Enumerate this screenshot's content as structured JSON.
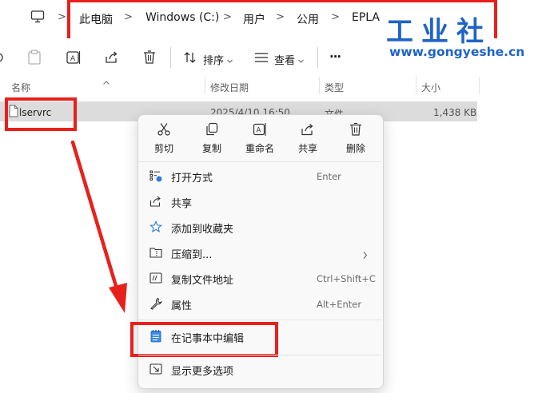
{
  "breadcrumb": {
    "items": [
      "此电脑",
      "Windows (C:)",
      "用户",
      "公用",
      "EPLA"
    ]
  },
  "toolbar": {
    "sort_label": "排序",
    "view_label": "查看",
    "more_label": "···"
  },
  "columns": {
    "name": "名称",
    "date": "修改日期",
    "type": "类型",
    "size": "大小"
  },
  "file": {
    "name": "lservrc",
    "date": "2025/4/10 16:50",
    "type": "文件",
    "size": "1,438 KB"
  },
  "context_menu": {
    "quick_actions": [
      {
        "label": "剪切",
        "icon": "scissors-icon"
      },
      {
        "label": "复制",
        "icon": "copy-icon"
      },
      {
        "label": "重命名",
        "icon": "rename-icon"
      },
      {
        "label": "共享",
        "icon": "share-icon"
      },
      {
        "label": "删除",
        "icon": "trash-icon"
      }
    ],
    "items": [
      {
        "label": "打开方式",
        "shortcut": "Enter",
        "icon": "open-with-icon"
      },
      {
        "label": "共享",
        "shortcut": "",
        "icon": "share-icon"
      },
      {
        "label": "添加到收藏夹",
        "shortcut": "",
        "icon": "star-icon"
      },
      {
        "label": "压缩到...",
        "shortcut": "",
        "icon": "zip-folder-icon"
      },
      {
        "label": "复制文件地址",
        "shortcut": "Ctrl+Shift+C",
        "icon": "copy-path-icon"
      },
      {
        "label": "属性",
        "shortcut": "Alt+Enter",
        "icon": "wrench-icon"
      }
    ],
    "notepad_item": {
      "label": "在记事本中编辑",
      "icon": "notepad-icon"
    },
    "more_item": {
      "label": "显示更多选项",
      "icon": "more-options-icon"
    }
  },
  "watermark": {
    "title": "工业社",
    "url": "www.gongyeshe.cn"
  },
  "colors": {
    "highlight_red": "#e8201c",
    "watermark_blue": "#1e64c8",
    "selected_row": "#dcdcdc",
    "menu_bg": "#f9f9f9"
  }
}
